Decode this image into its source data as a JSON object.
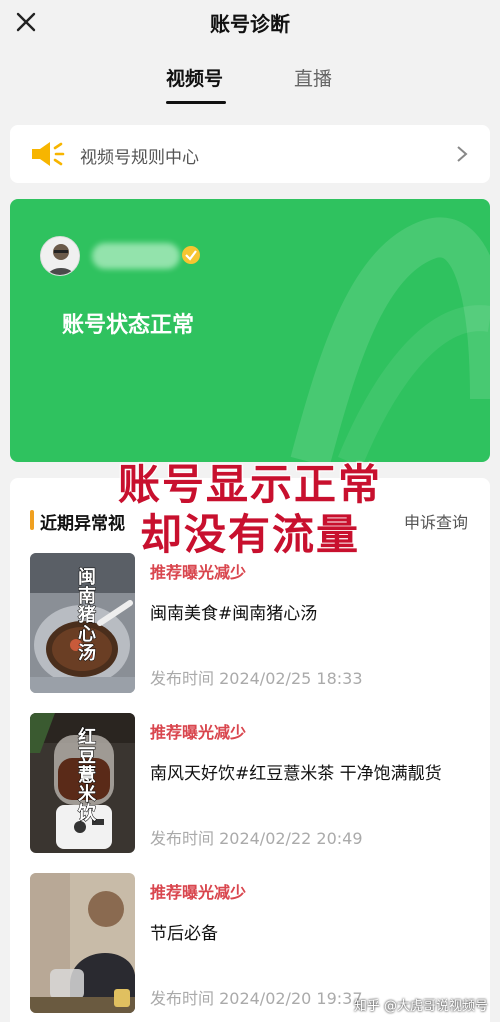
{
  "header": {
    "title": "账号诊断",
    "close_icon": "close-icon"
  },
  "tabs": [
    {
      "label": "视频号",
      "active": true
    },
    {
      "label": "直播",
      "active": false
    }
  ],
  "rules": {
    "label": "视频号规则中心",
    "icon": "speaker-icon"
  },
  "status": {
    "text": "账号状态正常",
    "color": "#2fc25f",
    "verified_icon": "verified-badge-icon"
  },
  "overlay": {
    "line1": "账号显示正常",
    "line2": "却没有流量"
  },
  "section": {
    "title": "近期异常视",
    "appeal": "申诉查询"
  },
  "items": [
    {
      "thumb_label": "闽南猪心汤",
      "tag": "推荐曝光减少",
      "title": "闽南美食#闽南猪心汤",
      "time": "发布时间 2024/02/25 18:33"
    },
    {
      "thumb_label": "红豆薏米饮",
      "tag": "推荐曝光减少",
      "title": "南风天好饮#红豆薏米茶 干净饱满靓货",
      "time": "发布时间 2024/02/22 20:49"
    },
    {
      "thumb_label": "",
      "tag": "推荐曝光减少",
      "title": "节后必备",
      "time": "发布时间 2024/02/20 19:37"
    }
  ],
  "watermark": "知乎 @大虎哥说视频号",
  "colors": {
    "accent_green": "#2fc25f",
    "warning_red": "#d9464e",
    "overlay_red": "#c8102e"
  }
}
